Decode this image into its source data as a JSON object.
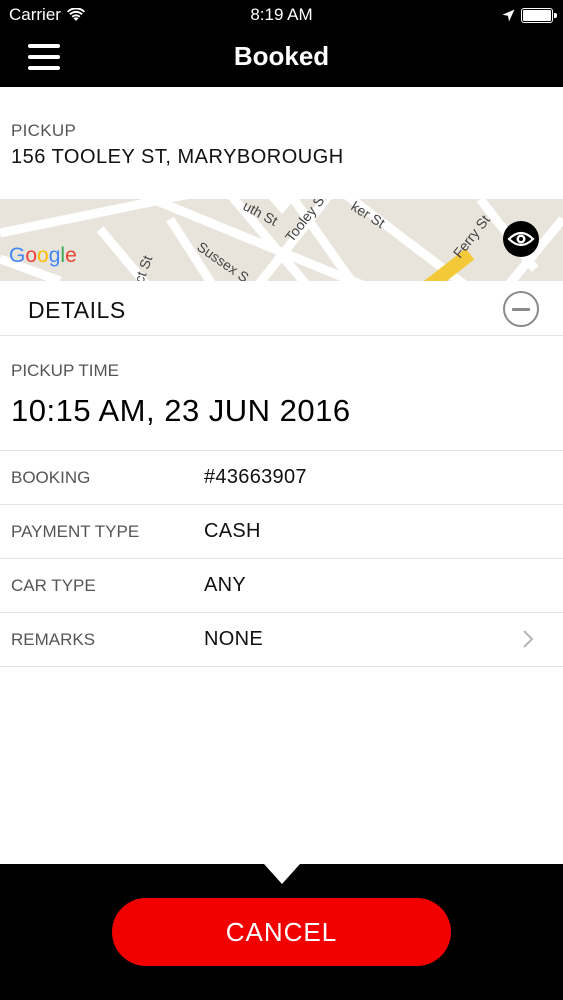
{
  "status_bar": {
    "carrier": "Carrier",
    "time": "8:19 AM"
  },
  "nav": {
    "title": "Booked"
  },
  "pickup": {
    "label": "PICKUP",
    "address": "156 TOOLEY ST, MARYBOROUGH"
  },
  "map": {
    "google_logo": [
      "G",
      "o",
      "o",
      "g",
      "l",
      "e"
    ],
    "street_labels": [
      "uth St",
      "Tooley St",
      "ker St",
      "Ferry St",
      "Sussex S",
      "ct St"
    ]
  },
  "details": {
    "title": "DETAILS",
    "pickup_time_label": "PICKUP TIME",
    "pickup_time_value": "10:15 AM, 23 JUN 2016",
    "rows": [
      {
        "label": "BOOKING",
        "value": "#43663907"
      },
      {
        "label": "PAYMENT TYPE",
        "value": "CASH"
      },
      {
        "label": "CAR TYPE",
        "value": "ANY"
      },
      {
        "label": "REMARKS",
        "value": "NONE"
      }
    ]
  },
  "actions": {
    "cancel_label": "CANCEL"
  },
  "colors": {
    "bar_background": "#000000",
    "cancel_button": "#f20000",
    "google_blue": "#4285f4",
    "google_red": "#ea4335",
    "google_yellow": "#fbbc05",
    "google_green": "#34a853"
  }
}
